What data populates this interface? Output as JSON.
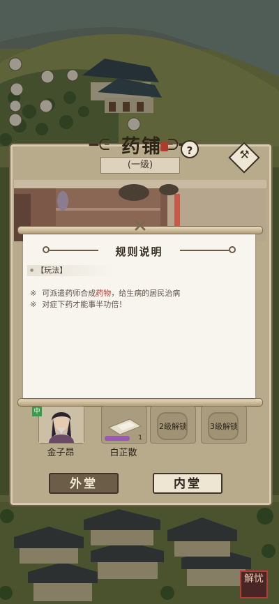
{
  "shop": {
    "title": "药铺",
    "level": "(一级)",
    "help": "?"
  },
  "rules": {
    "title": "规则说明",
    "section": "【玩法】",
    "lines": [
      {
        "mark": "※",
        "before": "可派遣药师合成",
        "highlight": "药物",
        "after": "，给生病的居民治病"
      },
      {
        "mark": "※",
        "text": "对症下药才能事半功倍！"
      }
    ]
  },
  "slots": [
    {
      "name": "金子昂",
      "badge": "中"
    },
    {
      "name": "白芷散",
      "count": "1"
    },
    {
      "lock_text": "2级解锁"
    },
    {
      "lock_text": "3级解锁"
    }
  ],
  "tabs": {
    "outer": "外堂",
    "inner": "内堂"
  },
  "seal": "解忧",
  "colors": {
    "highlight": "#c2352b",
    "panel": "#b7ab8c",
    "paper": "#f7f5ee"
  }
}
